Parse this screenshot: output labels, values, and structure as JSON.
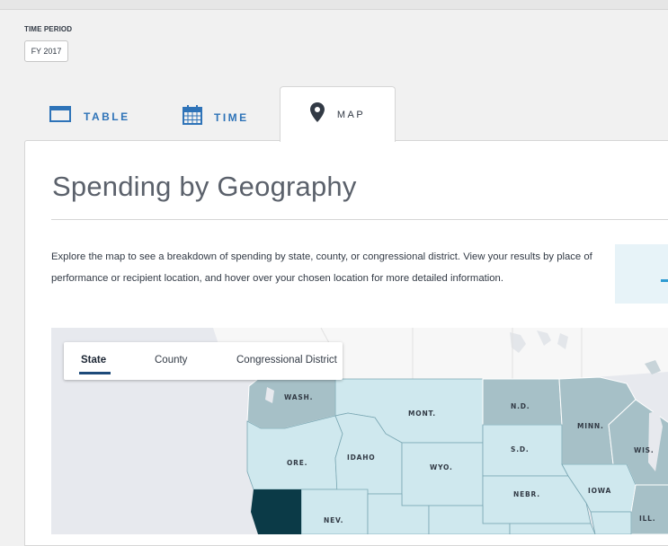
{
  "time_period": {
    "label": "TIME PERIOD",
    "value": "FY 2017"
  },
  "tabs": [
    {
      "label": "TABLE",
      "icon": "table-icon",
      "active": false
    },
    {
      "label": "TIME",
      "icon": "calendar-icon",
      "active": false
    },
    {
      "label": "MAP",
      "icon": "map-pin-icon",
      "active": true
    }
  ],
  "section": {
    "title": "Spending by Geography",
    "description": "Explore the map to see a breakdown of spending by state, county, or congressional district. View your results by place of performance or recipient location, and hover over your chosen location for more detailed information."
  },
  "map_toggle": {
    "options": [
      "State",
      "County",
      "Congressional District"
    ],
    "selected": "State"
  },
  "map": {
    "state_labels": [
      "WASH.",
      "MONT.",
      "N.D.",
      "MINN.",
      "ORE.",
      "IDAHO",
      "WYO.",
      "S.D.",
      "WIS.",
      "NEBR.",
      "IOWA",
      "NEV.",
      "ILL."
    ]
  },
  "colors": {
    "accent_blue": "#2e73b8",
    "map_light": "#cfe8ee",
    "map_mid": "#a6c0c7",
    "map_dark": "#0b3a47",
    "map_background": "#e7e9ee"
  }
}
